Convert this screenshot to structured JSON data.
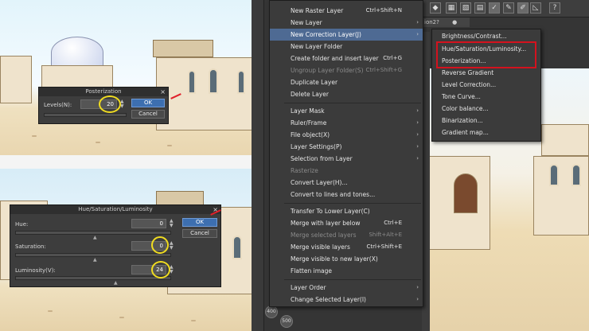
{
  "posterization_dialog": {
    "title": "Posterization",
    "levels_label": "Levels(N):",
    "levels_value": "20",
    "ok_label": "OK",
    "cancel_label": "Cancel"
  },
  "hsl_dialog": {
    "title": "Hue/Saturation/Luminosity",
    "hue_label": "Hue:",
    "hue_value": "0",
    "saturation_label": "Saturation:",
    "saturation_value": "0",
    "luminosity_label": "Luminosity(V):",
    "luminosity_value": "24",
    "ok_label": "OK",
    "cancel_label": "Cancel"
  },
  "canvas_tab": {
    "label": "ion2?"
  },
  "side_buttons": [
    "400",
    "500"
  ],
  "layer_menu": {
    "items": [
      {
        "label": "New Raster Layer",
        "shortcut": "Ctrl+Shift+N"
      },
      {
        "label": "New Layer",
        "arrow": "›"
      },
      {
        "label": "New Correction Layer(J)",
        "arrow": "›"
      },
      {
        "label": "New Layer Folder"
      },
      {
        "label": "Create folder and insert layer",
        "shortcut": "Ctrl+G"
      },
      {
        "label": "Ungroup Layer Folder(S)",
        "shortcut": "Ctrl+Shift+G"
      },
      {
        "label": "Duplicate Layer"
      },
      {
        "label": "Delete Layer"
      },
      {
        "label": "Layer Mask",
        "arrow": "›"
      },
      {
        "label": "Ruler/Frame",
        "arrow": "›"
      },
      {
        "label": "File object(X)",
        "arrow": "›"
      },
      {
        "label": "Layer Settings(P)",
        "arrow": "›"
      },
      {
        "label": "Selection from Layer",
        "arrow": "›"
      },
      {
        "label": "Rasterize"
      },
      {
        "label": "Convert Layer(H)..."
      },
      {
        "label": "Convert to lines and tones..."
      },
      {
        "label": "Transfer To Lower Layer(C)"
      },
      {
        "label": "Merge with layer below",
        "shortcut": "Ctrl+E"
      },
      {
        "label": "Merge selected layers",
        "shortcut": "Shift+Alt+E"
      },
      {
        "label": "Merge visible layers",
        "shortcut": "Ctrl+Shift+E"
      },
      {
        "label": "Merge visible to new layer(X)"
      },
      {
        "label": "Flatten image"
      },
      {
        "label": "Layer Order",
        "arrow": "›"
      },
      {
        "label": "Change Selected Layer(I)",
        "arrow": "›"
      }
    ]
  },
  "correction_submenu": {
    "items": [
      "Brightness/Contrast...",
      "Hue/Saturation/Luminosity...",
      "Posterization...",
      "Reverse Gradient",
      "Level Correction...",
      "Tone Curve...",
      "Color balance...",
      "Binarization...",
      "Gradient map..."
    ]
  },
  "colors": {
    "highlight": "#4e6a93",
    "annotation_circle": "#f0dc20",
    "annotation_box": "#d4121e",
    "ok_button": "#3d6fb0"
  }
}
